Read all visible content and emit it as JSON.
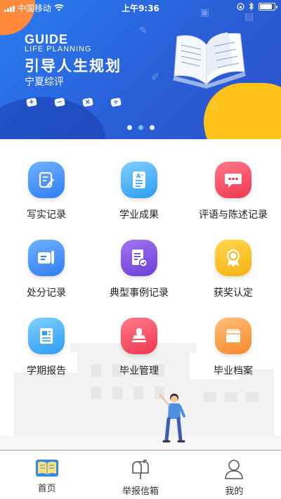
{
  "status_bar": {
    "carrier": "中国移动",
    "time": "上午9:36",
    "battery_level": 0.85
  },
  "banner": {
    "title_en": "GUIDE",
    "subtitle_en": "LIFE PLANNING",
    "title_cn": "引导人生规划",
    "org": "宁夏综评",
    "operators": [
      "+",
      "−",
      "×",
      "÷"
    ],
    "active_slide": 2,
    "slide_count": 3,
    "colors": {
      "background": "#2a5fd8",
      "orange_blob": "#ff8a3c",
      "yellow_blob": "#ffc21a"
    }
  },
  "menu": {
    "items": [
      {
        "label": "写实记录",
        "icon": "note-edit-icon",
        "color": "#2f7df2"
      },
      {
        "label": "学业成果",
        "icon": "grade-document-icon",
        "color": "#2d9cf0"
      },
      {
        "label": "评语与陈述记录",
        "icon": "chat-bubble-icon",
        "color": "#f0364f"
      },
      {
        "label": "处分记录",
        "icon": "pen-card-icon",
        "color": "#2f7df2"
      },
      {
        "label": "典型事例记录",
        "icon": "checklist-icon",
        "color": "#6b3fd8"
      },
      {
        "label": "获奖认定",
        "icon": "award-medal-icon",
        "color": "#f5b210"
      },
      {
        "label": "学期报告",
        "icon": "report-icon",
        "color": "#2d9cf0"
      },
      {
        "label": "毕业管理",
        "icon": "stamp-icon",
        "color": "#f0364f"
      },
      {
        "label": "毕业档案",
        "icon": "archive-folder-icon",
        "color": "#f5872b"
      }
    ]
  },
  "tabbar": {
    "tabs": [
      {
        "label": "首页",
        "icon": "book-icon",
        "active": true
      },
      {
        "label": "举报信箱",
        "icon": "mailbox-icon",
        "active": false
      },
      {
        "label": "我的",
        "icon": "user-icon",
        "active": false
      }
    ]
  }
}
